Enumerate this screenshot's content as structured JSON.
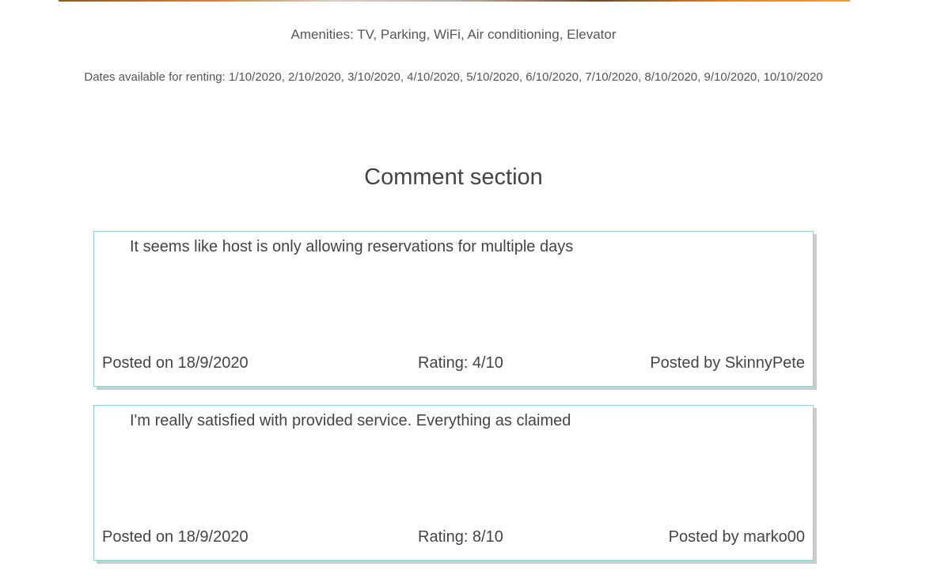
{
  "listing": {
    "amenities_text": "Amenities: TV, Parking, WiFi, Air conditioning, Elevator",
    "dates_text": "Dates available for renting: 1/10/2020, 2/10/2020, 3/10/2020, 4/10/2020, 5/10/2020, 6/10/2020, 7/10/2020, 8/10/2020, 9/10/2020, 10/10/2020"
  },
  "comments_section": {
    "title": "Comment section",
    "comments": [
      {
        "text": "It seems like host is only allowing reservations for multiple days",
        "posted_on": "Posted on 18/9/2020",
        "rating": "Rating: 4/10",
        "posted_by": "Posted by SkinnyPete"
      },
      {
        "text": "I'm really satisfied with provided service. Everything as claimed",
        "posted_on": "Posted on 18/9/2020",
        "rating": "Rating: 8/10",
        "posted_by": "Posted by marko00"
      }
    ]
  },
  "colors": {
    "card_border": "#8fd3cc",
    "card_shadow": "#cccccc",
    "text": "#444444"
  }
}
